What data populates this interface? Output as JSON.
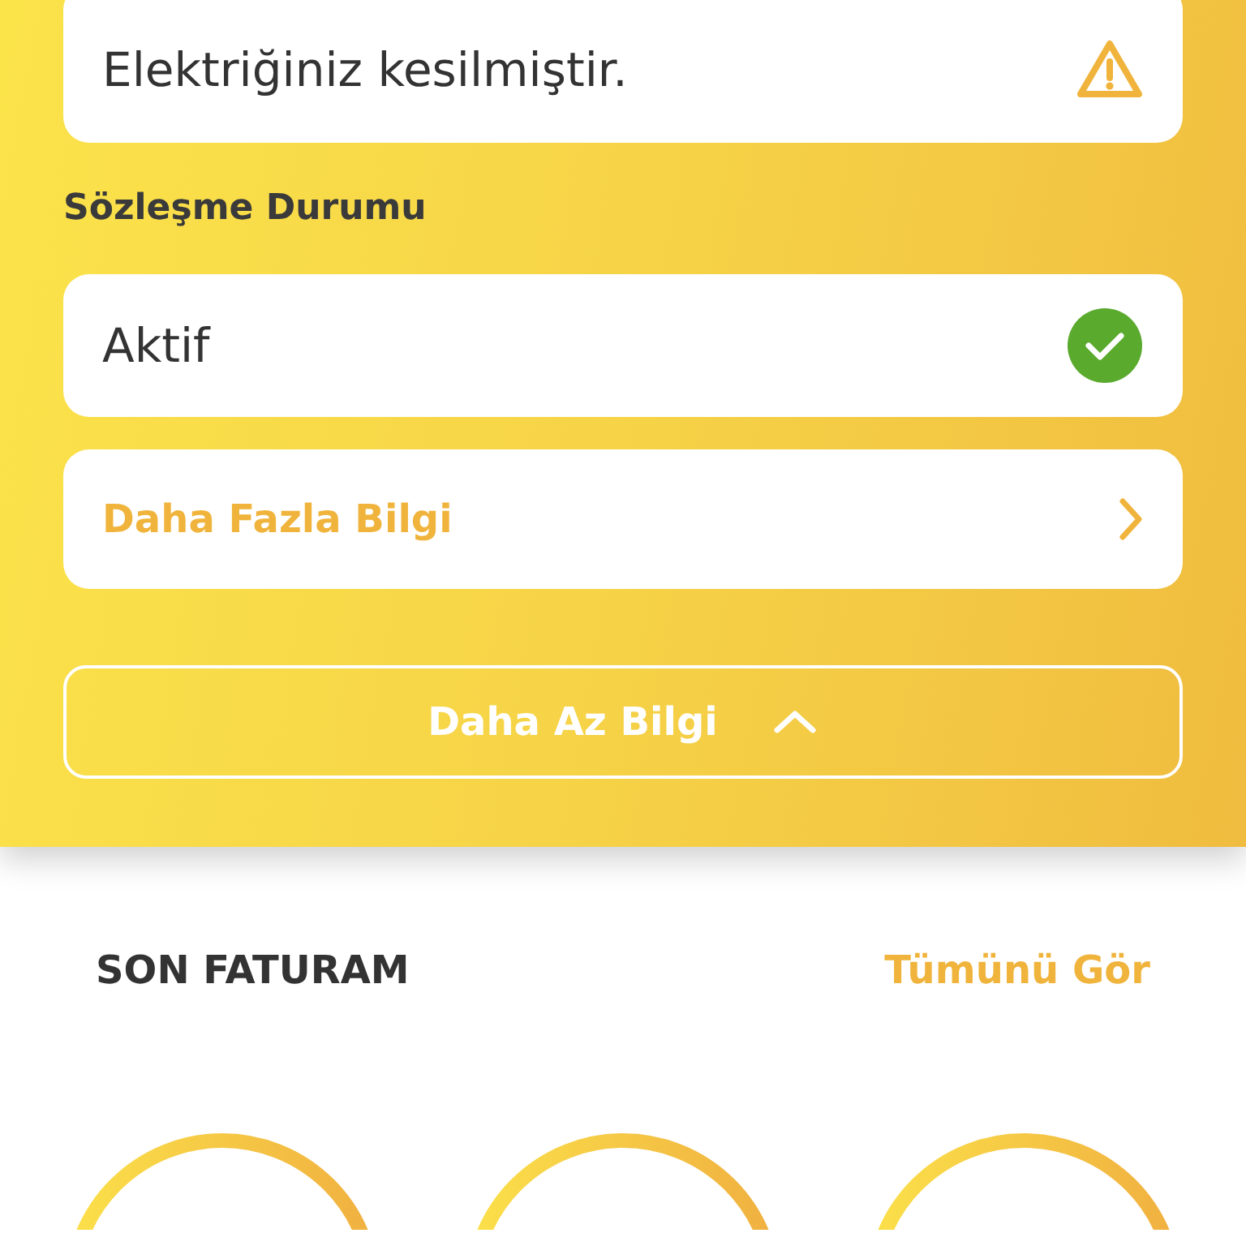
{
  "outage_notice": {
    "text": "Elektriğiniz kesilmiştir."
  },
  "contract_status": {
    "label": "Sözleşme Durumu",
    "value": "Aktif",
    "active": true
  },
  "more_info_link": {
    "label": "Daha Fazla Bilgi"
  },
  "less_info_button": {
    "label": "Daha Az Bilgi",
    "expanded": true
  },
  "last_bill": {
    "title": "SON FATURAM",
    "see_all": "Tümünü Gör"
  }
}
